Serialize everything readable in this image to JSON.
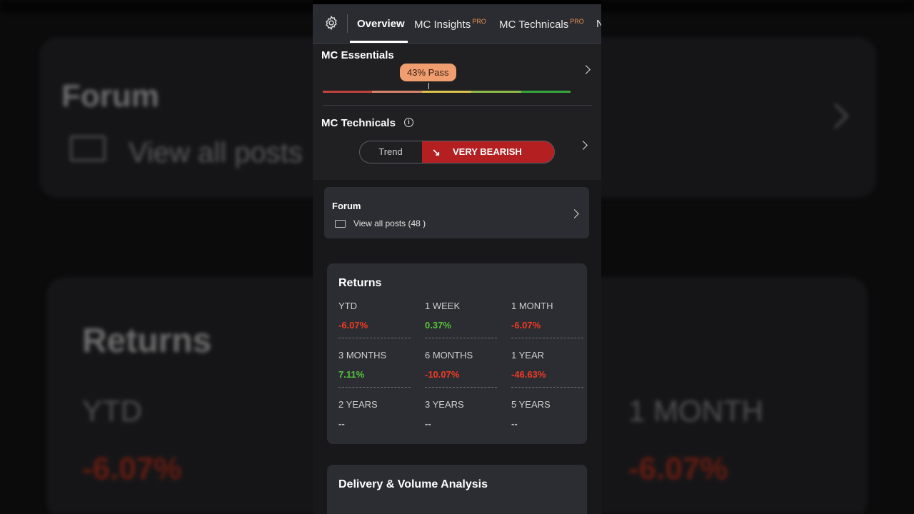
{
  "background": {
    "forum_title": "Forum",
    "view_all": "View all posts",
    "returns_title": "Returns",
    "ytd_label": "YTD",
    "ytd_value": "-6.07%",
    "month_label": "1 MONTH",
    "month_value": "-6.07%"
  },
  "tabs": [
    {
      "label": "Overview",
      "pro": "",
      "active": true
    },
    {
      "label": "MC Insights",
      "pro": "PRO"
    },
    {
      "label": "MC Technicals",
      "pro": "PRO"
    },
    {
      "label": "N",
      "pro": ""
    }
  ],
  "essentials": {
    "title": "MC Essentials",
    "pass_badge": "43% Pass",
    "pass_fraction": 0.43,
    "meter_colors": [
      "#c0443d",
      "#d6846a",
      "#d9c24d",
      "#8fb94a",
      "#38a43d"
    ]
  },
  "technicals": {
    "title": "MC Technicals",
    "trend_label": "Trend",
    "trend_value": "VERY BEARISH",
    "trend_color": "#b41f22"
  },
  "forum": {
    "title": "Forum",
    "view_all": "View all posts (48 )"
  },
  "returns": {
    "title": "Returns",
    "items": [
      {
        "label": "YTD",
        "value": "-6.07%",
        "tone": "neg"
      },
      {
        "label": "1 WEEK",
        "value": "0.37%",
        "tone": "pos"
      },
      {
        "label": "1 MONTH",
        "value": "-6.07%",
        "tone": "neg"
      },
      {
        "label": "3 MONTHS",
        "value": "7.11%",
        "tone": "pos"
      },
      {
        "label": "6 MONTHS",
        "value": "-10.07%",
        "tone": "neg"
      },
      {
        "label": "1 YEAR",
        "value": "-46.63%",
        "tone": "neg"
      },
      {
        "label": "2 YEARS",
        "value": "--",
        "tone": "na"
      },
      {
        "label": "3 YEARS",
        "value": "--",
        "tone": "na"
      },
      {
        "label": "5 YEARS",
        "value": "--",
        "tone": "na"
      }
    ]
  },
  "delivery": {
    "title": "Delivery & Volume Analysis"
  },
  "colors": {
    "negative": "#f03a24",
    "positive": "#57c33b",
    "pro_badge": "#f0954f",
    "pass_badge": "#f09d6f"
  }
}
